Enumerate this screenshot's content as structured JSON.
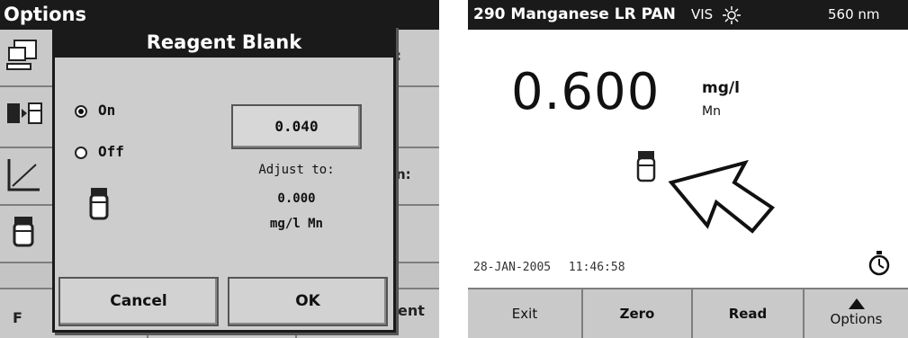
{
  "left_screen": {
    "title": "Options",
    "menu_items": [
      {
        "icon": "computer-icon",
        "trailing": ":"
      },
      {
        "icon": "vials-icon",
        "trailing": ""
      },
      {
        "icon": "calibration-curve-icon",
        "trailing": "n:"
      },
      {
        "icon": "sample-cell-icon",
        "trailing": ""
      }
    ],
    "bottom_buttons": [
      "F",
      "",
      "ent"
    ],
    "dialog": {
      "title": "Reagent Blank",
      "radio_on": "On",
      "radio_off": "Off",
      "selected": "On",
      "value": "0.040",
      "adjust_label": "Adjust to:",
      "adjust_value": "0.000",
      "adjust_unit": "mg/l Mn",
      "cancel_label": "Cancel",
      "ok_label": "OK"
    }
  },
  "right_screen": {
    "program": "290 Manganese LR PAN",
    "mode": "VIS",
    "wavelength": "560 nm",
    "reading": "0.600",
    "unit": "mg/l",
    "parameter": "Mn",
    "date": "28-JAN-2005",
    "time": "11:46:58",
    "buttons": {
      "exit": "Exit",
      "zero": "Zero",
      "read": "Read",
      "options": "Options"
    }
  }
}
